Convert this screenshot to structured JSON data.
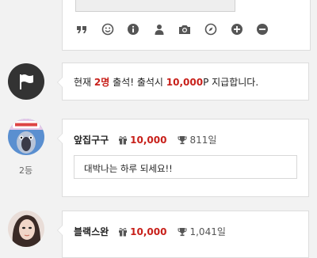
{
  "editor": {
    "toolbar_icons": [
      "quote-icon",
      "smiley-icon",
      "info-icon",
      "user-icon",
      "camera-icon",
      "compass-icon",
      "plus-icon",
      "minus-icon"
    ],
    "icon_color": "#555555"
  },
  "notice": {
    "prefix": "현재 ",
    "count": "2명",
    "middle": " 출석! 출석시 ",
    "reward": "10,000",
    "suffix": "P 지급합니다."
  },
  "entries": [
    {
      "rank": "2등",
      "username": "앞집구구",
      "points": "10,000",
      "days": "811일",
      "message": "대박나는 하루 되세요!!"
    },
    {
      "username": "블랙스완",
      "points": "10,000",
      "days": "1,041일"
    }
  ]
}
